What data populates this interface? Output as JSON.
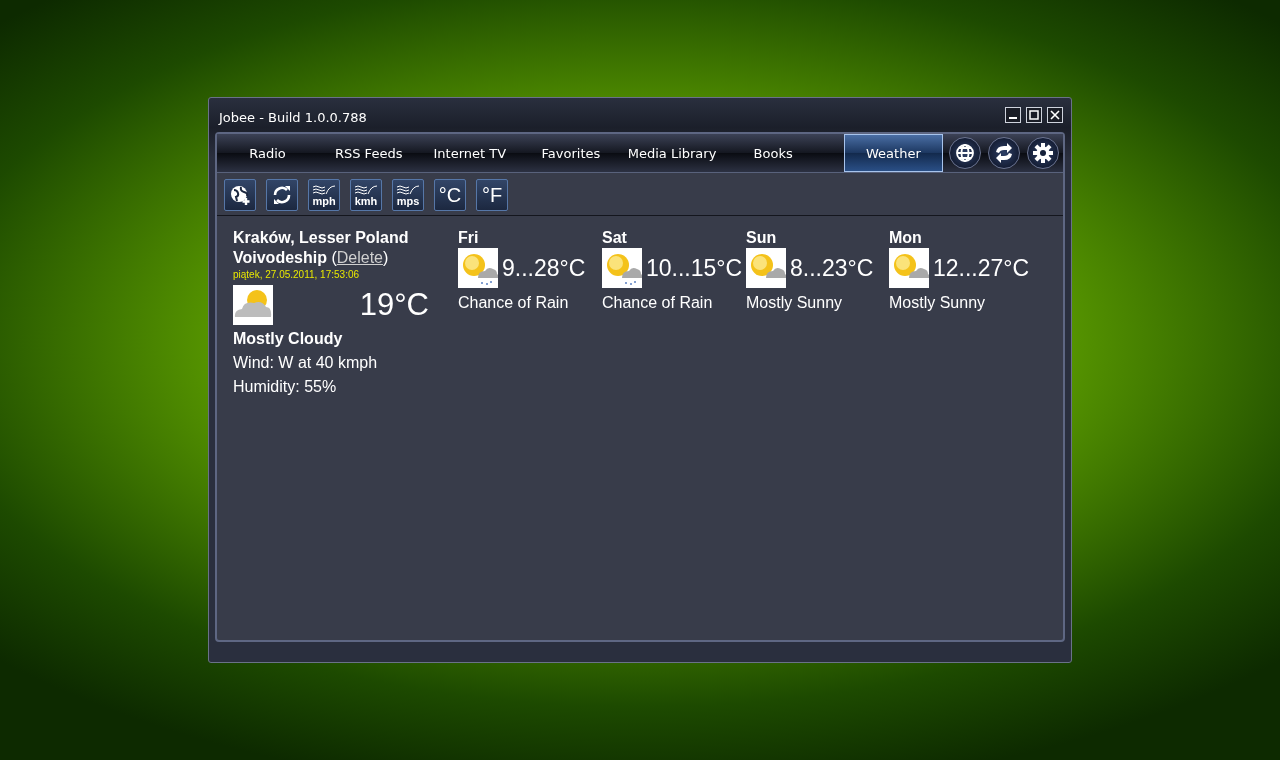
{
  "window": {
    "title": "Jobee - Build 1.0.0.788"
  },
  "tabs": [
    {
      "label": "Radio",
      "selected": false
    },
    {
      "label": "RSS Feeds",
      "selected": false
    },
    {
      "label": "Internet TV",
      "selected": false
    },
    {
      "label": "Favorites",
      "selected": false
    },
    {
      "label": "Media Library",
      "selected": false
    },
    {
      "label": "Books",
      "selected": false
    },
    {
      "label": "Weather",
      "selected": true
    }
  ],
  "toolbar": [
    {
      "kind": "add-location"
    },
    {
      "kind": "refresh"
    },
    {
      "kind": "wind-unit",
      "label": "mph"
    },
    {
      "kind": "wind-unit",
      "label": "kmh"
    },
    {
      "kind": "wind-unit",
      "label": "mps"
    },
    {
      "kind": "temp-unit",
      "label": "°C"
    },
    {
      "kind": "temp-unit",
      "label": "°F"
    }
  ],
  "current": {
    "location": "Kraków, Lesser Poland Voivodeship",
    "open": " (",
    "delete_link": "Delete",
    "close": ")",
    "timestamp": "piątek, 27.05.2011, 17:53:06",
    "kind": "cloudy",
    "temperature": "19°C",
    "condition": "Mostly Cloudy",
    "wind": "Wind: W at 40 kmph",
    "humidity": "Humidity: 55%"
  },
  "forecast": [
    {
      "day": "Fri",
      "kind": "rain",
      "range": "9...28°C",
      "condition": "Chance of Rain"
    },
    {
      "day": "Sat",
      "kind": "rain",
      "range": "10...15°C",
      "condition": "Chance of Rain"
    },
    {
      "day": "Sun",
      "kind": "sunny",
      "range": "8...23°C",
      "condition": "Mostly Sunny"
    },
    {
      "day": "Mon",
      "kind": "sunny",
      "range": "12...27°C",
      "condition": "Mostly Sunny"
    }
  ]
}
